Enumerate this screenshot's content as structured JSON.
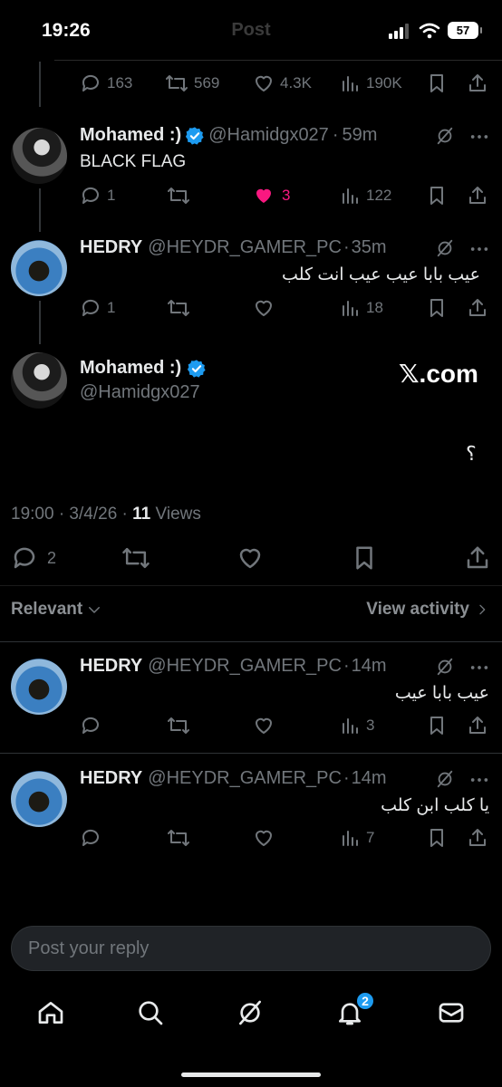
{
  "status_bar": {
    "time": "19:26",
    "battery": "57",
    "title": "Post"
  },
  "parent_stats": {
    "replies": "163",
    "reposts": "569",
    "likes": "4.3K",
    "views": "190K"
  },
  "reply_mohamed": {
    "name": "Mohamed :)",
    "handle": "@Hamidgx027",
    "time": "59m",
    "text": "BLACK FLAG",
    "replies": "1",
    "likes": "3",
    "views": "122",
    "like_color": "#f91880"
  },
  "reply_hedry_1": {
    "name": "HEDRY",
    "handle": "@HEYDR_GAMER_PC",
    "time": "35m",
    "text": "عيب بابا عيب عيب انت كلب",
    "replies": "1",
    "views": "18"
  },
  "main_post": {
    "name": "Mohamed :)",
    "handle": "@Hamidgx027",
    "source": "𝕏.com",
    "text": "؟",
    "timestamp": "19:00 · 3/4/26 · ",
    "views_count": "11",
    "views_label": " Views",
    "replies": "2"
  },
  "filter": {
    "sort_label": "Relevant",
    "activity_label": "View activity"
  },
  "replies": [
    {
      "name": "HEDRY",
      "handle": "@HEYDR_GAMER_PC",
      "time": "14m",
      "text": "عيب بابا عيب",
      "views": "3"
    },
    {
      "name": "HEDRY",
      "handle": "@HEYDR_GAMER_PC",
      "time": "14m",
      "text": "يا كلب ابن كلب",
      "views": "7"
    }
  ],
  "reply_box": {
    "placeholder": "Post your reply"
  },
  "bottom_nav": {
    "notifications_badge": "2"
  },
  "colors": {
    "accent": "#1d9bf0",
    "like": "#f91880",
    "background": "#000000"
  }
}
